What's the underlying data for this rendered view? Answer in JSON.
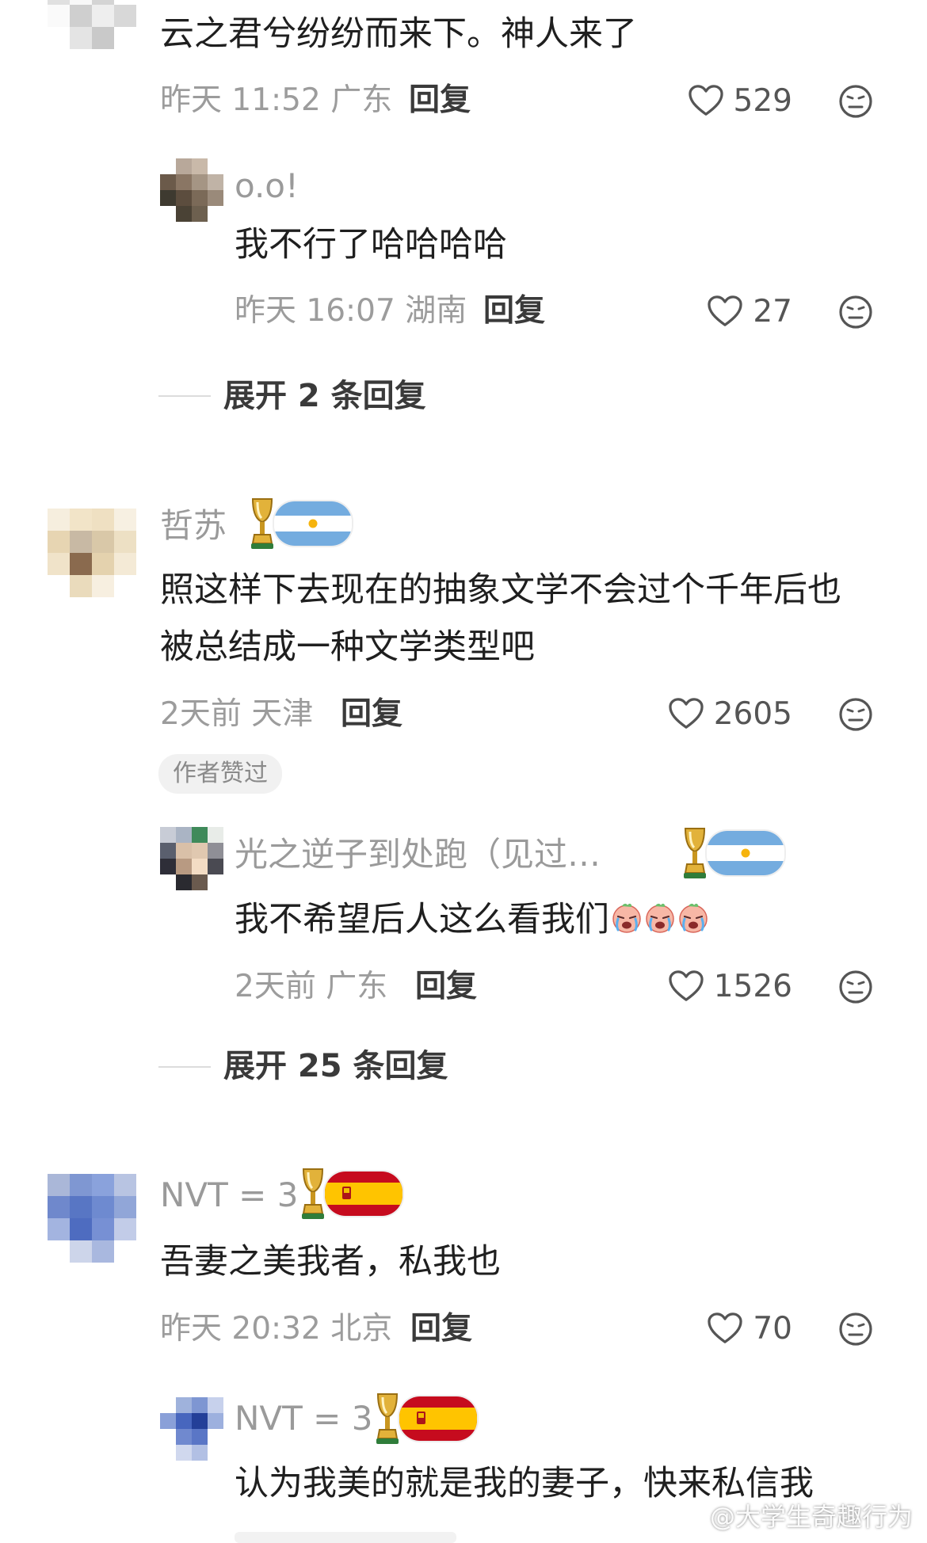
{
  "comments": [
    {
      "text": "云之君兮纷纷而来下。神人来了",
      "time": "昨天 11:52",
      "location": "广东",
      "reply_label": "回复",
      "likes": "529",
      "replies": [
        {
          "username": "o.o!",
          "text": "我不行了哈哈哈哈",
          "time": "昨天 16:07",
          "location": "湖南",
          "reply_label": "回复",
          "likes": "27"
        }
      ],
      "expand_label": "展开 2 条回复"
    },
    {
      "username": "哲苏",
      "badge_flag": "argentina",
      "text_lines": [
        "照这样下去现在的抽象文学不会过个千年后也",
        "被总结成一种文学类型吧"
      ],
      "time": "2天前",
      "location": "天津",
      "reply_label": "回复",
      "likes": "2605",
      "author_liked": "作者赞过",
      "replies": [
        {
          "username": "光之逆子到处跑（见过…",
          "badge_flag": "argentina",
          "text": "我不希望后人这么看我们",
          "emoji": "crying-face-emoji",
          "time": "2天前",
          "location": "广东",
          "reply_label": "回复",
          "likes": "1526"
        }
      ],
      "expand_label": "展开 25 条回复"
    },
    {
      "username": "NVT = 3",
      "badge_flag": "spain",
      "text": "吾妻之美我者，私我也",
      "time": "昨天 20:32",
      "location": "北京",
      "reply_label": "回复",
      "likes": "70",
      "replies": [
        {
          "username": "NVT = 3",
          "badge_flag": "spain",
          "text": "认为我美的就是我的妻子，快来私信我"
        }
      ]
    }
  ],
  "watermark": "@大学生奇趣行为",
  "colors": {
    "background": "#ffffff",
    "body_text": "#1f1f1f",
    "meta_text": "#9c9c9c",
    "argentina_blue": "#74acdf",
    "spain_red": "#c60b1e",
    "spain_yellow": "#ffc400",
    "trophy_gold": "#d4a017"
  }
}
